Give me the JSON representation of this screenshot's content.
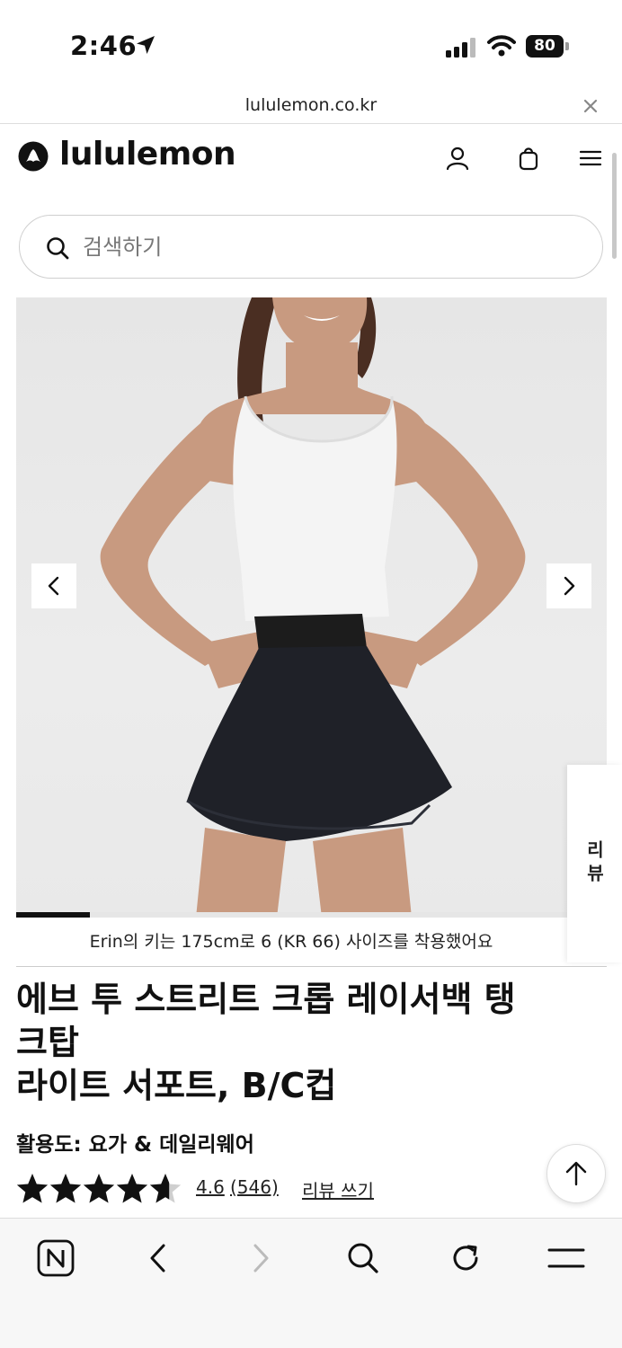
{
  "status_bar": {
    "time": "2:46",
    "battery": "80"
  },
  "url_bar": {
    "url": "lululemon.co.kr"
  },
  "header": {
    "logo_text": "lululemon"
  },
  "search": {
    "placeholder": "검색하기"
  },
  "gallery": {
    "progress_fraction": 0.125,
    "fit_note": "Erin의 키는 175cm로 6 (KR 66) 사이즈를 착용했어요"
  },
  "review_tab": {
    "label": "리뷰"
  },
  "product": {
    "title_line1": "에브 투 스트리트 크롭 레이서백 탱",
    "title_line2": "크탑",
    "title_line3": "라이트 서포트, B/C컵",
    "activity": "활용도: 요가 & 데일리웨어",
    "rating_value": "4.6",
    "rating_fraction": 0.92,
    "review_count": "(546)",
    "write_review": "리뷰 쓰기"
  },
  "icons": {
    "location": "location-arrow-icon",
    "signal": "signal-icon",
    "wifi": "wifi-icon",
    "close": "close-icon",
    "account": "account-icon",
    "bag": "shopping-bag-icon",
    "menu": "menu-icon",
    "search": "search-icon",
    "prev": "chevron-left-icon",
    "next": "chevron-right-icon",
    "scroll_top": "arrow-up-icon",
    "naver": "naver-n-icon",
    "browser_back": "back-icon",
    "browser_forward": "forward-icon",
    "browser_search": "search-icon",
    "refresh": "refresh-icon",
    "browser_menu": "menu-icon"
  }
}
